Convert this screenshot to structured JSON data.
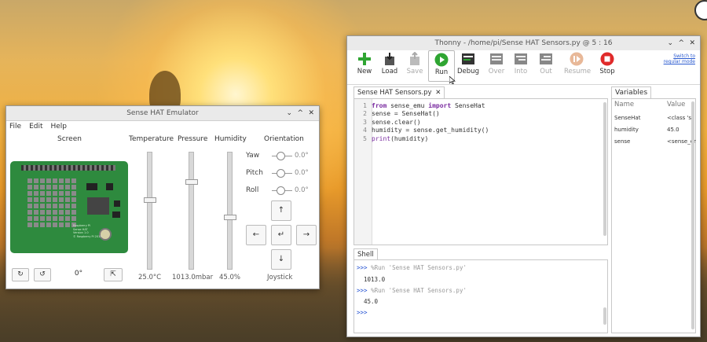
{
  "sense_hat": {
    "title": "Sense HAT Emulator",
    "menu": [
      "File",
      "Edit",
      "Help"
    ],
    "headers": {
      "screen": "Screen",
      "temperature": "Temperature",
      "pressure": "Pressure",
      "humidity": "Humidity",
      "orientation": "Orientation"
    },
    "board_text": {
      "r1": "Raspberry Pi",
      "r2": "Sense HAT",
      "r3": "Version 1.0",
      "r4": "© Raspberry Pi 2015"
    },
    "values": {
      "temperature": "25.0°C",
      "pressure": "1013.0mbar",
      "humidity": "45.0%"
    },
    "levels": {
      "temperature": 0.6,
      "pressure": 0.76,
      "humidity": 0.45
    },
    "orientation": {
      "yaw": {
        "label": "Yaw",
        "value": "0.0°"
      },
      "pitch": {
        "label": "Pitch",
        "value": "0.0°"
      },
      "roll": {
        "label": "Roll",
        "value": "0.0°"
      }
    },
    "joystick": {
      "label": "Joystick",
      "up": "↑",
      "down": "↓",
      "left": "←",
      "right": "→",
      "enter": "↵"
    },
    "rotation": {
      "cw": "↻",
      "ccw": "↺",
      "angle": "0°",
      "flip": "⇱"
    }
  },
  "thonny": {
    "title": "Thonny  -  /home/pi/Sense HAT Sensors.py  @  5 : 16",
    "switch_mode": "Switch to\nregular mode",
    "toolbar": {
      "new": "New",
      "load": "Load",
      "save": "Save",
      "run": "Run",
      "debug": "Debug",
      "over": "Over",
      "into": "Into",
      "out": "Out",
      "resume": "Resume",
      "stop": "Stop"
    },
    "editor_tab": "Sense HAT Sensors.py",
    "code": [
      {
        "n": "1",
        "kw1": "from",
        "mid": " sense_emu ",
        "kw2": "import",
        "rest": " SenseHat"
      },
      {
        "n": "2",
        "kw1": "",
        "mid": "sense = SenseHat()",
        "kw2": "",
        "rest": ""
      },
      {
        "n": "3",
        "kw1": "",
        "mid": "sense.clear()",
        "kw2": "",
        "rest": ""
      },
      {
        "n": "4",
        "kw1": "",
        "mid": "humidity = sense.get_humidity()",
        "kw2": "",
        "rest": ""
      },
      {
        "n": "5",
        "kw1": "",
        "mid": "print(humidity)",
        "kw2": "",
        "rest": ""
      }
    ],
    "shell_tab": "Shell",
    "shell": {
      "prompt": ">>>",
      "cmd1": "%Run 'Sense HAT Sensors.py'",
      "out1": "1013.0",
      "cmd2": "%Run 'Sense HAT Sensors.py'",
      "out2": "45.0"
    },
    "variables": {
      "tab": "Variables",
      "col_name": "Name",
      "col_value": "Value",
      "rows": [
        {
          "name": "SenseHat",
          "value": "<class 'se"
        },
        {
          "name": "humidity",
          "value": "45.0"
        },
        {
          "name": "sense",
          "value": "<sense_er"
        }
      ]
    }
  }
}
